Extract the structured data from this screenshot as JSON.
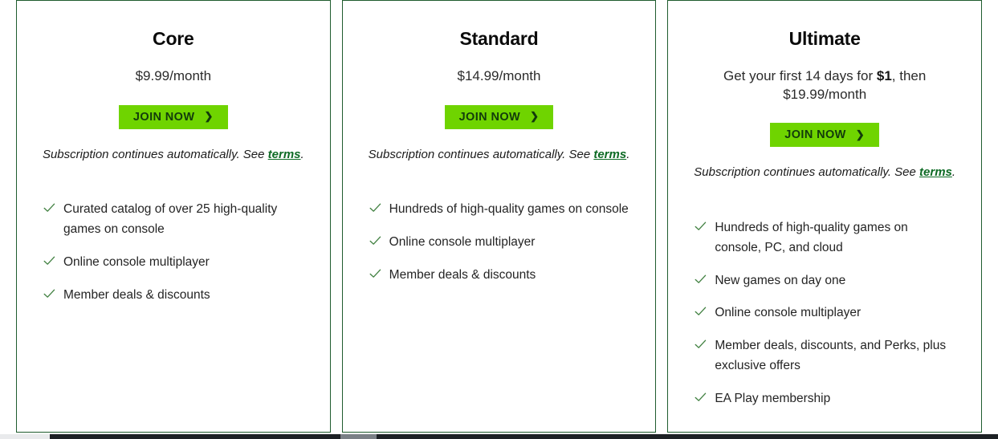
{
  "theme": {
    "card_border": "#1f5c2e",
    "button_bg": "#6fd400",
    "button_text": "#123b0b",
    "link_color": "#0e6b25",
    "check_color": "#3f7f3f",
    "body_text": "#242424"
  },
  "plans": [
    {
      "name": "Core",
      "price_line_1": "$9.99/month",
      "price_line_2": "",
      "price_bold": "",
      "cta_label": "JOIN NOW",
      "cta_icon": "chevron-right-icon",
      "auto_renew_prefix": "Subscription continues automatically. See ",
      "terms_link": "terms",
      "auto_renew_suffix": ".",
      "features": [
        "Curated catalog of over 25 high-quality games on console",
        "Online console multiplayer",
        "Member deals & discounts"
      ]
    },
    {
      "name": "Standard",
      "price_line_1": "$14.99/month",
      "price_line_2": "",
      "price_bold": "",
      "cta_label": "JOIN NOW",
      "cta_icon": "chevron-right-icon",
      "auto_renew_prefix": "Subscription continues automatically. See ",
      "terms_link": "terms",
      "auto_renew_suffix": ".",
      "features": [
        "Hundreds of high-quality games on console",
        "Online console multiplayer",
        "Member deals & discounts"
      ]
    },
    {
      "name": "Ultimate",
      "price_line_1": "Get your first 14 days for ",
      "price_bold": "$1",
      "price_line_2": ", then $19.99/month",
      "cta_label": "JOIN NOW",
      "cta_icon": "chevron-right-icon",
      "auto_renew_prefix": "Subscription continues automatically. See ",
      "terms_link": "terms",
      "auto_renew_suffix": ".",
      "features": [
        "Hundreds of high-quality games on console, PC, and cloud",
        "New games on day one",
        "Online console multiplayer",
        "Member deals, discounts, and Perks, plus exclusive offers",
        "EA Play membership"
      ]
    }
  ]
}
